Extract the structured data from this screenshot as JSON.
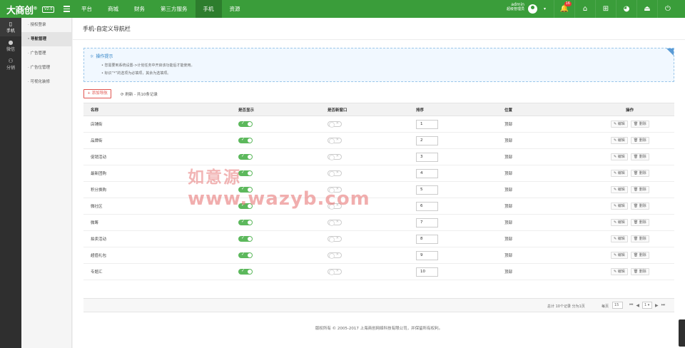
{
  "brand": {
    "logo": "大商创",
    "version": "V2.0"
  },
  "nav": [
    "平台",
    "商城",
    "财务",
    "第三方服务",
    "手机",
    "资源"
  ],
  "user": {
    "name": "admin",
    "role": "超级管理员",
    "notifications": "16"
  },
  "left_menu": [
    {
      "icon": "▯",
      "label": "手机"
    },
    {
      "icon": "●",
      "label": "微信"
    },
    {
      "icon": "⚇",
      "label": "分销"
    }
  ],
  "sub_menu": [
    "授权登录",
    "导航管理",
    "广告管理",
    "广告位管理",
    "可视化装修"
  ],
  "page": {
    "title": "手机-自定义导航栏"
  },
  "tips": {
    "title": "操作提示",
    "items": [
      "您需要到系统设置->计划任务中开启该功能后才能使用。",
      "标识“*”的选项为必填项，其余为选填项。"
    ]
  },
  "toolbar": {
    "add_label": "添加导航",
    "refresh_label": "刷新 - 共10条记录"
  },
  "table": {
    "columns": [
      "名称",
      "是否显示",
      "是否新窗口",
      "排序",
      "位置",
      "操作"
    ],
    "rows": [
      {
        "name": "店铺街",
        "show": true,
        "new_window": false,
        "sort": "1",
        "position": "顶部"
      },
      {
        "name": "品牌街",
        "show": true,
        "new_window": false,
        "sort": "2",
        "position": "顶部"
      },
      {
        "name": "促销活动",
        "show": true,
        "new_window": false,
        "sort": "3",
        "position": "顶部"
      },
      {
        "name": "最新团购",
        "show": true,
        "new_window": false,
        "sort": "4",
        "position": "顶部"
      },
      {
        "name": "积分换购",
        "show": true,
        "new_window": false,
        "sort": "5",
        "position": "顶部"
      },
      {
        "name": "微社区",
        "show": true,
        "new_window": false,
        "sort": "6",
        "position": "顶部"
      },
      {
        "name": "微筹",
        "show": true,
        "new_window": false,
        "sort": "7",
        "position": "顶部"
      },
      {
        "name": "拍卖活动",
        "show": true,
        "new_window": false,
        "sort": "8",
        "position": "顶部"
      },
      {
        "name": "超值礼包",
        "show": true,
        "new_window": false,
        "sort": "9",
        "position": "顶部"
      },
      {
        "name": "专题汇",
        "show": true,
        "new_window": false,
        "sort": "10",
        "position": "顶部"
      }
    ],
    "edit_label": "编辑",
    "delete_label": "删除"
  },
  "pagination": {
    "total": "总计 10个记录 分为1页",
    "per_page_label": "每页",
    "per_page": "15",
    "current": "1"
  },
  "footer": "版权所有 © 2005-2017 上海商创网络科技有限公司，并保留所有权利。",
  "watermark": {
    "line1": "如意源",
    "line2": "www.wazyb.com"
  },
  "colors": {
    "brand_green": "#3a9d3a",
    "active_nav": "#2d7d2d",
    "danger": "#e0544f"
  }
}
